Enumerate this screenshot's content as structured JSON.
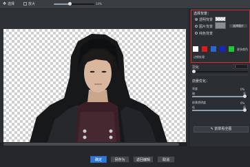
{
  "toolbar": {
    "select_label": "选择",
    "zoom_label": "放大",
    "zoom_value": "14%",
    "zoom_fraction": 0.4
  },
  "bg_panel": {
    "title": "选择背景：",
    "transparent_label": "透明背景",
    "image_label": "图片背景",
    "choose_image_button": "选择图片",
    "solid_label": "纯色背景",
    "more_colors_label": "更多颜色",
    "swatch_colors": [
      "#ffffff",
      "#e11b1b",
      "#2b66d9",
      "#1526c9",
      "#20c63a"
    ],
    "extra_label": "边缘处理",
    "feather_label": "羽化",
    "feather_value": "1",
    "feather_fraction": 0.02
  },
  "adjust": {
    "title": "前景优化：",
    "bright_label": "亮度",
    "bright_sub": "暗",
    "bright_right": "亮",
    "bright_value": "0%",
    "bright_fraction": 0.95,
    "contrast_label": "前景透明度",
    "contrast_sub": "低",
    "contrast_right": "高",
    "contrast_value": "0%",
    "contrast_fraction": 0.95,
    "fx_button": "前景看全图"
  },
  "footer": {
    "ok": "确定",
    "save_as": "另存为",
    "reset": "返回编辑",
    "cancel": "取消"
  }
}
